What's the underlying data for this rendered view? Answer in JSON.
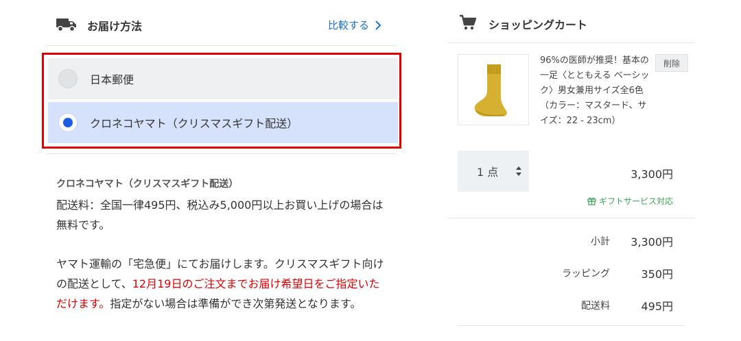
{
  "delivery": {
    "section_title": "お届け方法",
    "compare_label": "比較する",
    "options": [
      {
        "label": "日本郵便",
        "selected": false
      },
      {
        "label": "クロネコヤマト（クリスマスギフト配送）",
        "selected": true
      }
    ],
    "detail": {
      "title": "クロネコヤマト（クリスマスギフト配送）",
      "para1": "配送料：全国一律495円、税込み5,000円以上お買い上げの場合は無料です。",
      "para2_before": "ヤマト運輸の「宅急便」にてお届けします。クリスマスギフト向けの配送として、",
      "para2_highlight": "12月19日のご注文までお届け希望日をご指定いただけます。",
      "para2_after": "指定がない場合は準備ができ次第発送となります。"
    }
  },
  "cart": {
    "title": "ショッピングカート",
    "item": {
      "name": "96%の医師が推奨！基本の一足〈とともえる ベーシック〉男女兼用サイズ全6色（カラー：マスタード、サイズ：22 - 23cm）",
      "delete_label": "削除",
      "quantity_label": "1 点",
      "price": "3,300円",
      "gift_label": "ギフトサービス対応"
    },
    "summary": [
      {
        "label": "小計",
        "value": "3,300円"
      },
      {
        "label": "ラッピング",
        "value": "350円"
      },
      {
        "label": "配送料",
        "value": "495円"
      }
    ]
  },
  "colors": {
    "accent": "#1a73c8",
    "highlight_box": "#e00000",
    "selected_bg": "#d6e2fb",
    "gift_green": "#3aa35a"
  },
  "icons": [
    "truck-icon",
    "chevron-right-icon",
    "cart-icon",
    "sort-arrows-icon",
    "gift-icon"
  ]
}
